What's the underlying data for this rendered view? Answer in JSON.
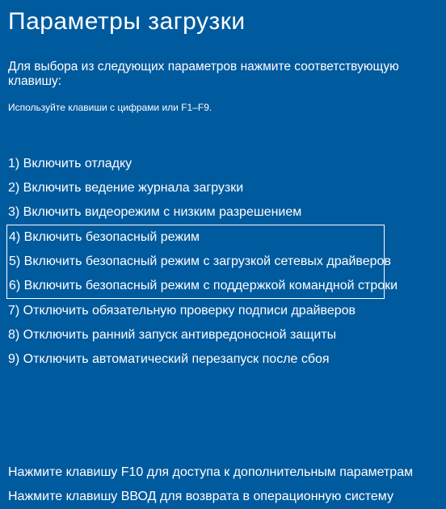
{
  "title": "Параметры загрузки",
  "subtitle": "Для выбора из следующих параметров нажмите соответствующую клавишу:",
  "hint": "Используйте клавиши с цифрами или F1–F9.",
  "options": [
    "1) Включить отладку",
    "2) Включить ведение журнала загрузки",
    "3) Включить видеорежим с низким разрешением",
    "4) Включить безопасный режим",
    "5) Включить безопасный режим с загрузкой сетевых драйверов",
    "6) Включить безопасный режим с поддержкой командной строки",
    "7) Отключить обязательную проверку подписи драйверов",
    "8) Отключить ранний запуск антивредоносной защиты",
    "9) Отключить автоматический перезапуск после сбоя"
  ],
  "footer": {
    "f10": "Нажмите клавишу F10 для доступа к дополнительным параметрам",
    "enter": "Нажмите клавишу ВВОД для возврата в операционную систему"
  }
}
